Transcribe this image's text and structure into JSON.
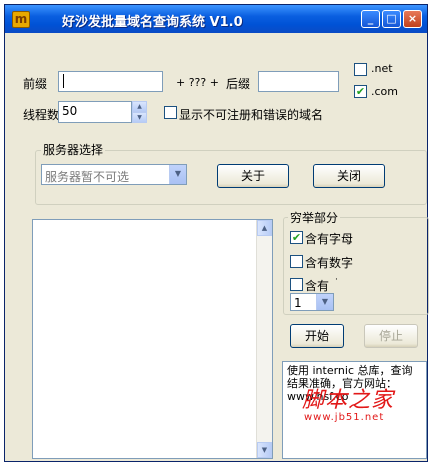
{
  "window": {
    "app_icon_text": "m",
    "title": "好沙发批量域名查询系统 V1.0",
    "controls": [
      "_",
      "□",
      "×"
    ]
  },
  "prefix": {
    "label": "前缀",
    "value": ""
  },
  "joiner": {
    "text": "+ ??? +"
  },
  "suffix": {
    "label": "后缀",
    "value": ""
  },
  "tld": {
    "net": {
      "label": ".net",
      "checked": false
    },
    "com": {
      "label": ".com",
      "checked": true
    }
  },
  "threads": {
    "label": "线程数",
    "value": "50"
  },
  "hide_invalid": {
    "label": "显示不可注册和错误的域名",
    "checked": false
  },
  "server": {
    "group_title": "服务器选择",
    "selected": "服务器暂不可选",
    "about_label": "关于",
    "close_label": "关闭"
  },
  "enum": {
    "group_title": "穷举部分",
    "letters": {
      "label": "含有字母",
      "checked": true
    },
    "digits": {
      "label": "含有数字",
      "checked": false
    },
    "contains": {
      "label": "含有",
      "checked": false,
      "count": "1"
    }
  },
  "actions": {
    "start_label": "开始",
    "stop_label": "停止"
  },
  "info_text": "使用 internic 总库，查询结果准确，官方网站：www.hsf.co",
  "watermark": {
    "text": "脚本之家",
    "url": "www.jb51.net"
  },
  "colors": {
    "title_bar": "#0a5fe0",
    "window_bg": "#ece9d8",
    "watermark": "#e21818"
  }
}
